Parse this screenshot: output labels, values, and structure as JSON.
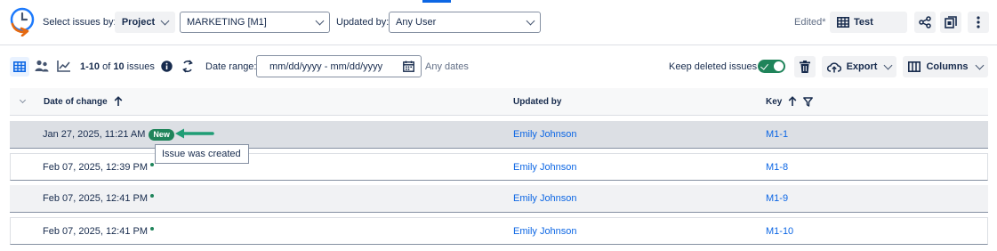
{
  "header": {
    "select_issues_by_label": "Select issues by:",
    "project_button": "Project",
    "project_select_value": "MARKETING [M1]",
    "updated_by_label": "Updated by:",
    "updated_by_value": "Any User",
    "edited_label": "Edited*",
    "view_name": "Test"
  },
  "toolbar": {
    "count_range": "1-10",
    "count_of": "of",
    "count_total": "10",
    "count_suffix": "issues",
    "date_range_label": "Date range:",
    "date_range_placeholder": "mm/dd/yyyy - mm/dd/yyyy",
    "any_dates": "Any dates",
    "keep_deleted_label": "Keep deleted issues",
    "keep_deleted_on": true,
    "export_label": "Export",
    "columns_label": "Columns"
  },
  "table": {
    "columns": [
      "Date of change",
      "Updated by",
      "Key"
    ],
    "rows": [
      {
        "date": "Jan 27, 2025, 11:21 AM",
        "updated_by": "Emily Johnson",
        "key": "M1-1",
        "badge": "New"
      },
      {
        "date": "Feb 07, 2025, 12:39 PM",
        "updated_by": "Emily Johnson",
        "key": "M1-8"
      },
      {
        "date": "Feb 07, 2025, 12:41 PM",
        "updated_by": "Emily Johnson",
        "key": "M1-9"
      },
      {
        "date": "Feb 07, 2025, 12:41 PM",
        "updated_by": "Emily Johnson",
        "key": "M1-10"
      }
    ],
    "tooltip": "Issue was created"
  },
  "colors": {
    "accent": "#0c66e4",
    "success": "#1f845a",
    "logo_orange": "#e56910",
    "logo_blue": "#1d7afc"
  }
}
